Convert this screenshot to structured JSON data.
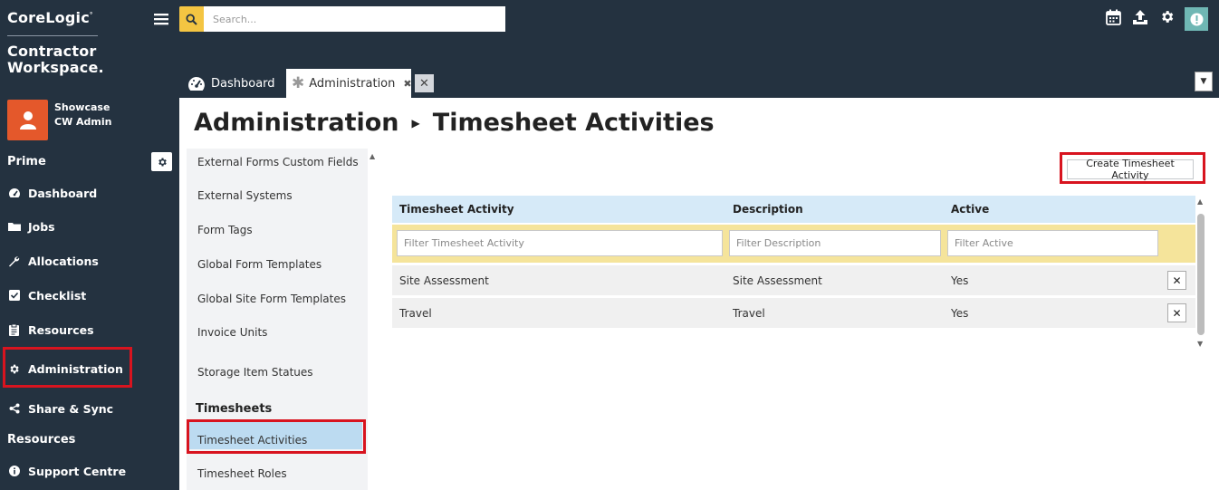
{
  "brand": {
    "logo": "CoreLogic",
    "product_line1": "Contractor",
    "product_line2": "Workspace."
  },
  "user": {
    "company": "Showcase",
    "name": "CW Admin"
  },
  "sidebar": {
    "section_prime": "Prime",
    "section_resources": "Resources",
    "items": [
      {
        "label": "Dashboard",
        "icon": "gauge-icon"
      },
      {
        "label": "Jobs",
        "icon": "folder-icon"
      },
      {
        "label": "Allocations",
        "icon": "wrench-icon"
      },
      {
        "label": "Checklist",
        "icon": "checkbox-icon"
      },
      {
        "label": "Resources",
        "icon": "clipboard-icon"
      },
      {
        "label": "Administration",
        "icon": "gear-icon"
      },
      {
        "label": "Share & Sync",
        "icon": "share-icon"
      },
      {
        "label": "Support Centre",
        "icon": "info-icon"
      }
    ]
  },
  "search": {
    "placeholder": "Search..."
  },
  "tabs": [
    {
      "label": "Dashboard",
      "icon": "gauge-icon"
    },
    {
      "label": "Administration",
      "icon": "asterisk-icon"
    }
  ],
  "page": {
    "title": "Administration",
    "subtitle": "Timesheet Activities"
  },
  "submenu": {
    "items": [
      "External Forms Custom Fields",
      "External Systems",
      "Form Tags",
      "Global Form Templates",
      "Global Site Form Templates",
      "Invoice Units",
      "Storage Item Statues"
    ],
    "section_timesheets": "Timesheets",
    "timesheet_items": [
      "Timesheet Activities",
      "Timesheet Roles"
    ]
  },
  "toolbar": {
    "create_label": "Create Timesheet Activity"
  },
  "grid": {
    "columns": [
      "Timesheet Activity",
      "Description",
      "Active"
    ],
    "filters": [
      "Filter Timesheet Activity",
      "Filter Description",
      "Filter Active"
    ],
    "rows": [
      {
        "activity": "Site Assessment",
        "description": "Site Assessment",
        "active": "Yes"
      },
      {
        "activity": "Travel",
        "description": "Travel",
        "active": "Yes"
      }
    ]
  },
  "colors": {
    "sidebar_bg": "#243240",
    "accent_yellow": "#f4c542",
    "avatar_orange": "#e4582b",
    "highlight_red": "#d8141f",
    "header_blue": "#d6eaf8"
  }
}
